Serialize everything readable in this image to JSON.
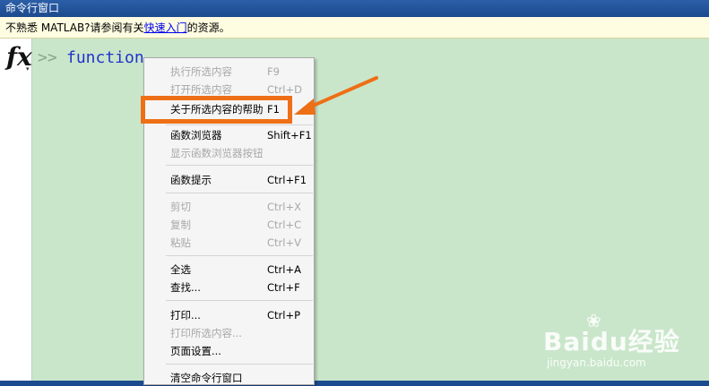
{
  "window": {
    "title": "命令行窗口"
  },
  "info_bar": {
    "prefix": "不熟悉 MATLAB?请参阅有关",
    "link": "快速入门",
    "suffix": "的资源。"
  },
  "command": {
    "prompt": ">>",
    "text": "function",
    "fx_label": "fx",
    "fx_caret": "▾"
  },
  "context_menu": {
    "items": [
      {
        "label": "执行所选内容",
        "shortcut": "F9",
        "enabled": false
      },
      {
        "label": "打开所选内容",
        "shortcut": "Ctrl+D",
        "enabled": false
      },
      {
        "label": "关于所选内容的帮助",
        "shortcut": "F1",
        "enabled": true,
        "highlighted": true
      },
      {
        "label": "函数浏览器",
        "shortcut": "Shift+F1",
        "enabled": true
      },
      {
        "label": "显示函数浏览器按钮",
        "shortcut": "",
        "enabled": false
      },
      {
        "label": "函数提示",
        "shortcut": "Ctrl+F1",
        "enabled": true
      },
      {
        "label": "剪切",
        "shortcut": "Ctrl+X",
        "enabled": false
      },
      {
        "label": "复制",
        "shortcut": "Ctrl+C",
        "enabled": false
      },
      {
        "label": "粘贴",
        "shortcut": "Ctrl+V",
        "enabled": false
      },
      {
        "label": "全选",
        "shortcut": "Ctrl+A",
        "enabled": true
      },
      {
        "label": "查找...",
        "shortcut": "Ctrl+F",
        "enabled": true
      },
      {
        "label": "打印...",
        "shortcut": "Ctrl+P",
        "enabled": true
      },
      {
        "label": "打印所选内容...",
        "shortcut": "",
        "enabled": false
      },
      {
        "label": "页面设置...",
        "shortcut": "",
        "enabled": true
      },
      {
        "label": "清空命令行窗口",
        "shortcut": "",
        "enabled": true
      }
    ]
  },
  "annotation": {
    "highlight_color": "#ee6f16",
    "arrow_color": "#ee6f16"
  },
  "watermark": {
    "brand": "Baidu经验",
    "url": "jingyan.baidu.com"
  }
}
